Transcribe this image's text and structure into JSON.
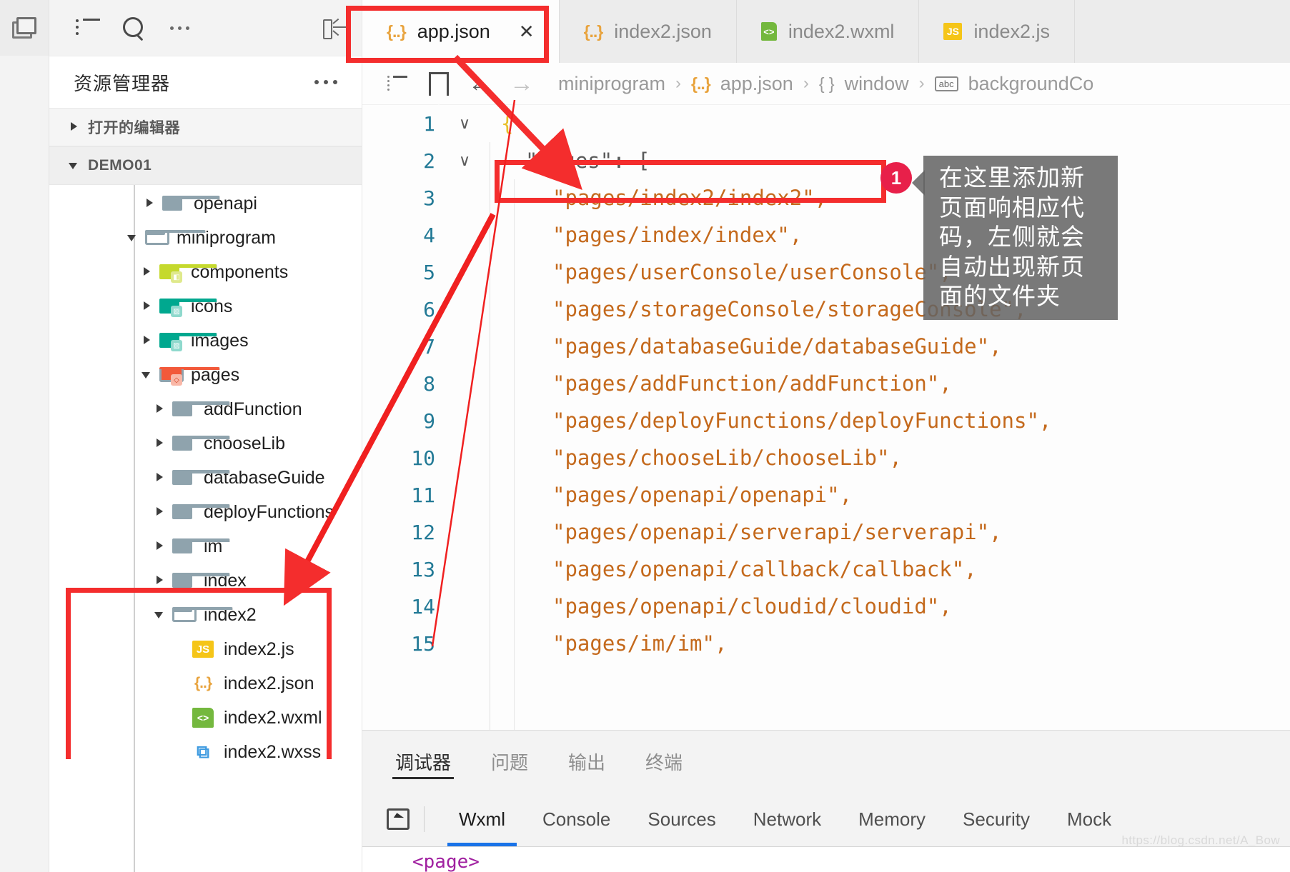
{
  "activity_bar": {
    "items": [
      {
        "name": "split-editor-icon",
        "label": ""
      }
    ]
  },
  "sidebar": {
    "toolbar": {
      "list_icon": "list-icon",
      "search_icon": "search-icon",
      "more_icon": "ellipsis-icon",
      "collapse_icon": "collapse-sidebar-icon"
    },
    "title": "资源管理器",
    "sections": [
      {
        "label": "打开的编辑器",
        "expanded": false
      },
      {
        "label": "DEMO01",
        "expanded": true
      }
    ],
    "tree": [
      {
        "label": "openapi",
        "type": "folder",
        "icon": "folder-icon",
        "expanded": false,
        "depth": 1
      },
      {
        "label": "miniprogram",
        "type": "folder-open",
        "icon": "folder-open-icon",
        "expanded": true,
        "depth": 1
      },
      {
        "label": "components",
        "type": "folder-components",
        "icon": "folder-components-icon",
        "expanded": false,
        "depth": 2
      },
      {
        "label": "icons",
        "type": "folder-images",
        "icon": "folder-images-icon",
        "expanded": false,
        "depth": 2
      },
      {
        "label": "images",
        "type": "folder-images",
        "icon": "folder-images-icon",
        "expanded": false,
        "depth": 2
      },
      {
        "label": "pages",
        "type": "folder-pages",
        "icon": "folder-pages-icon",
        "expanded": true,
        "depth": 2
      },
      {
        "label": "addFunction",
        "type": "folder",
        "icon": "folder-icon",
        "expanded": false,
        "depth": 3
      },
      {
        "label": "chooseLib",
        "type": "folder",
        "icon": "folder-icon",
        "expanded": false,
        "depth": 3
      },
      {
        "label": "databaseGuide",
        "type": "folder",
        "icon": "folder-icon",
        "expanded": false,
        "depth": 3
      },
      {
        "label": "deployFunctions",
        "type": "folder",
        "icon": "folder-icon",
        "expanded": false,
        "depth": 3
      },
      {
        "label": "im",
        "type": "folder",
        "icon": "folder-icon",
        "expanded": false,
        "depth": 3
      },
      {
        "label": "index",
        "type": "folder",
        "icon": "folder-icon",
        "expanded": false,
        "depth": 3
      },
      {
        "label": "index2",
        "type": "folder-open",
        "icon": "folder-open-icon",
        "expanded": true,
        "depth": 3
      },
      {
        "label": "index2.js",
        "type": "file-js",
        "icon": "js-file-icon",
        "depth": 4
      },
      {
        "label": "index2.json",
        "type": "file-json",
        "icon": "json-file-icon",
        "depth": 4
      },
      {
        "label": "index2.wxml",
        "type": "file-wxml",
        "icon": "wxml-file-icon",
        "depth": 4
      },
      {
        "label": "index2.wxss",
        "type": "file-wxss",
        "icon": "wxss-file-icon",
        "depth": 4
      }
    ]
  },
  "editor_tabs": [
    {
      "label": "app.json",
      "icon": "json-file-icon",
      "active": true,
      "closable": true,
      "close_label": "✕"
    },
    {
      "label": "index2.json",
      "icon": "json-file-icon",
      "active": false,
      "closable": false
    },
    {
      "label": "index2.wxml",
      "icon": "wxml-file-icon",
      "active": false,
      "closable": false
    },
    {
      "label": "index2.js",
      "icon": "js-file-icon",
      "active": false,
      "closable": false
    }
  ],
  "breadcrumb_toolbar": {
    "outline_icon": "outline-icon",
    "bookmark_icon": "bookmark-icon",
    "back_icon": "←",
    "forward_icon": "→"
  },
  "breadcrumb": [
    {
      "label": "miniprogram",
      "icon": null
    },
    {
      "label": "app.json",
      "icon": "json-file-icon"
    },
    {
      "label": "window",
      "icon": "object-icon"
    },
    {
      "label": "backgroundCo",
      "icon": "abc-icon"
    }
  ],
  "breadcrumb_chevron": "›",
  "code": {
    "lines": [
      {
        "n": "1",
        "fold": "∨",
        "indent": 0,
        "text": "{",
        "kind": "brace"
      },
      {
        "n": "2",
        "fold": "∨",
        "indent": 1,
        "text": "\"pages\": [",
        "kind": "key-array"
      },
      {
        "n": "3",
        "fold": "",
        "indent": 2,
        "text": "\"pages/index2/index2\",",
        "kind": "string"
      },
      {
        "n": "4",
        "fold": "",
        "indent": 2,
        "text": "\"pages/index/index\",",
        "kind": "string"
      },
      {
        "n": "5",
        "fold": "",
        "indent": 2,
        "text": "\"pages/userConsole/userConsole\",",
        "kind": "string"
      },
      {
        "n": "6",
        "fold": "",
        "indent": 2,
        "text": "\"pages/storageConsole/storageConsole\",",
        "kind": "string"
      },
      {
        "n": "7",
        "fold": "",
        "indent": 2,
        "text": "\"pages/databaseGuide/databaseGuide\",",
        "kind": "string"
      },
      {
        "n": "8",
        "fold": "",
        "indent": 2,
        "text": "\"pages/addFunction/addFunction\",",
        "kind": "string"
      },
      {
        "n": "9",
        "fold": "",
        "indent": 2,
        "text": "\"pages/deployFunctions/deployFunctions\",",
        "kind": "string"
      },
      {
        "n": "10",
        "fold": "",
        "indent": 2,
        "text": "\"pages/chooseLib/chooseLib\",",
        "kind": "string"
      },
      {
        "n": "11",
        "fold": "",
        "indent": 2,
        "text": "\"pages/openapi/openapi\",",
        "kind": "string"
      },
      {
        "n": "12",
        "fold": "",
        "indent": 2,
        "text": "\"pages/openapi/serverapi/serverapi\",",
        "kind": "string"
      },
      {
        "n": "13",
        "fold": "",
        "indent": 2,
        "text": "\"pages/openapi/callback/callback\",",
        "kind": "string"
      },
      {
        "n": "14",
        "fold": "",
        "indent": 2,
        "text": "\"pages/openapi/cloudid/cloudid\",",
        "kind": "string"
      },
      {
        "n": "15",
        "fold": "",
        "indent": 2,
        "text": "\"pages/im/im\",",
        "kind": "string"
      }
    ]
  },
  "panel": {
    "tabs": [
      {
        "label": "调试器",
        "active": true
      },
      {
        "label": "问题",
        "active": false
      },
      {
        "label": "输出",
        "active": false
      },
      {
        "label": "终端",
        "active": false
      }
    ],
    "devtools": {
      "inspect_icon": "inspect-element-icon",
      "tabs": [
        {
          "label": "Wxml",
          "active": true
        },
        {
          "label": "Console",
          "active": false
        },
        {
          "label": "Sources",
          "active": false
        },
        {
          "label": "Network",
          "active": false
        },
        {
          "label": "Memory",
          "active": false
        },
        {
          "label": "Security",
          "active": false
        },
        {
          "label": "Mock",
          "active": false
        }
      ],
      "content": "<page>"
    }
  },
  "annotations": {
    "callout_number": "1",
    "tooltip_text": "在这里添加新页面响相应代码，左侧就会自动出现新页面的文件夹",
    "highlight_color": "#f42d2d",
    "badge_color": "#e8204a"
  },
  "watermark": "https://blog.csdn.net/A_Bow"
}
